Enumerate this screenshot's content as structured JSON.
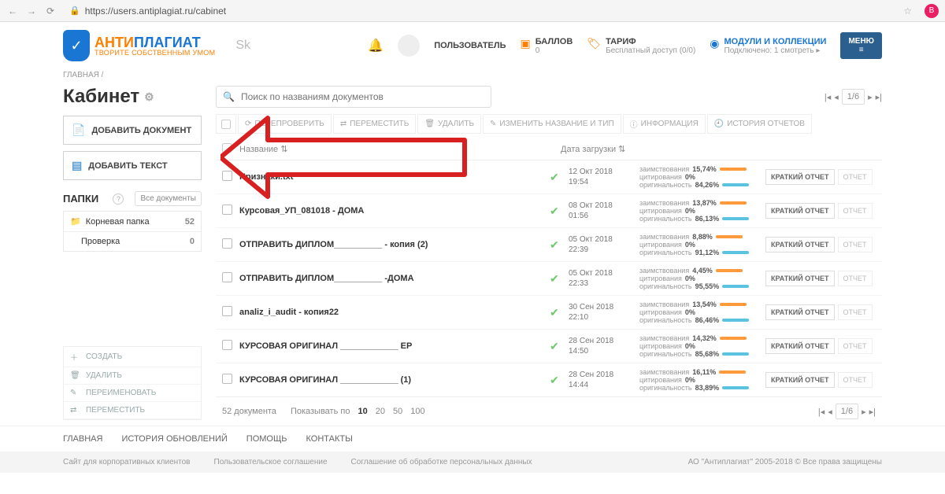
{
  "browser": {
    "url": "https://users.antiplagiat.ru/cabinet",
    "profile_initial": "В"
  },
  "logo": {
    "anti": "АНТИ",
    "plagiat": "ПЛАГИАТ",
    "tagline": "ТВОРИТЕ СОБСТВЕННЫМ УМОМ"
  },
  "header": {
    "user": "ПОЛЬЗОВАТЕЛЬ",
    "points_label": "БАЛЛОВ",
    "points_value": "0",
    "tariff_label": "ТАРИФ",
    "tariff_value": "Бесплатный доступ (0/0)",
    "modules_label": "МОДУЛИ И КОЛЛЕКЦИИ",
    "modules_value": "Подключено: 1 смотреть ▸",
    "menu": "МЕНЮ"
  },
  "crumb": "ГЛАВНАЯ /",
  "sidebar": {
    "title": "Кабинет",
    "add_doc": "ДОБАВИТЬ ДОКУМЕНТ",
    "add_text": "ДОБАВИТЬ ТЕКСТ",
    "folders_label": "ПАПКИ",
    "all_docs": "Все документы",
    "root": {
      "name": "Корневая папка",
      "count": "52"
    },
    "child": {
      "name": "Проверка",
      "count": "0"
    },
    "actions": {
      "create": "СОЗДАТЬ",
      "delete": "УДАЛИТЬ",
      "rename": "ПЕРЕИМЕНОВАТЬ",
      "move": "ПЕРЕМЕСТИТЬ"
    }
  },
  "search": {
    "placeholder": "Поиск по названиям документов"
  },
  "pager": {
    "page": "1/6"
  },
  "toolbar": {
    "recheck": "ПЕРЕПРОВЕРИТЬ",
    "move": "ПЕРЕМЕСТИТЬ",
    "delete": "УДАЛИТЬ",
    "rename": "ИЗМЕНИТЬ НАЗВАНИЕ И ТИП",
    "info": "ИНФОРМАЦИЯ",
    "history": "ИСТОРИЯ ОТЧЕТОВ"
  },
  "columns": {
    "name": "Название",
    "date": "Дата загрузки"
  },
  "metrics_labels": {
    "borrow": "заимствования",
    "cite": "цитирования",
    "orig": "оригинальность"
  },
  "buttons": {
    "brief": "КРАТКИЙ ОТЧЕТ",
    "report": "ОТЧЕТ"
  },
  "rows": [
    {
      "name": "Признаки.txt",
      "date1": "12 Окт 2018",
      "date2": "19:54",
      "borrow": "15,74%",
      "cite": "0%",
      "orig": "84,26%"
    },
    {
      "name": "Курсовая_УП_081018 - ДОМА",
      "date1": "08 Окт 2018",
      "date2": "01:56",
      "borrow": "13,87%",
      "cite": "0%",
      "orig": "86,13%"
    },
    {
      "name": "ОТПРАВИТЬ ДИПЛОМ__________ - копия (2)",
      "date1": "05 Окт 2018",
      "date2": "22:39",
      "borrow": "8,88%",
      "cite": "0%",
      "orig": "91,12%"
    },
    {
      "name": "ОТПРАВИТЬ ДИПЛОМ__________ -ДОМА",
      "date1": "05 Окт 2018",
      "date2": "22:33",
      "borrow": "4,45%",
      "cite": "0%",
      "orig": "95,55%"
    },
    {
      "name": "analiz_i_audit - копия22",
      "date1": "30 Сен 2018",
      "date2": "22:10",
      "borrow": "13,54%",
      "cite": "0%",
      "orig": "86,46%"
    },
    {
      "name": "КУРСОВАЯ ОРИГИНАЛ ____________ ЕР",
      "date1": "28 Сен 2018",
      "date2": "14:50",
      "borrow": "14,32%",
      "cite": "0%",
      "orig": "85,68%"
    },
    {
      "name": "КУРСОВАЯ ОРИГИНАЛ ____________ (1)",
      "date1": "28 Сен 2018",
      "date2": "14:44",
      "borrow": "16,11%",
      "cite": "0%",
      "orig": "83,89%"
    }
  ],
  "footer_table": {
    "total": "52 документа",
    "per_label": "Показывать по",
    "p10": "10",
    "p20": "20",
    "p50": "50",
    "p100": "100"
  },
  "footer_nav": {
    "main": "ГЛАВНАЯ",
    "history": "ИСТОРИЯ ОБНОВЛЕНИЙ",
    "help": "ПОМОЩЬ",
    "contacts": "КОНТАКТЫ"
  },
  "footer_sub": {
    "corp": "Сайт для корпоративных клиентов",
    "terms": "Пользовательское соглашение",
    "privacy": "Соглашение об обработке персональных данных",
    "copy": "АО \"Антиплагиат\" 2005-2018 © Все права защищены"
  }
}
